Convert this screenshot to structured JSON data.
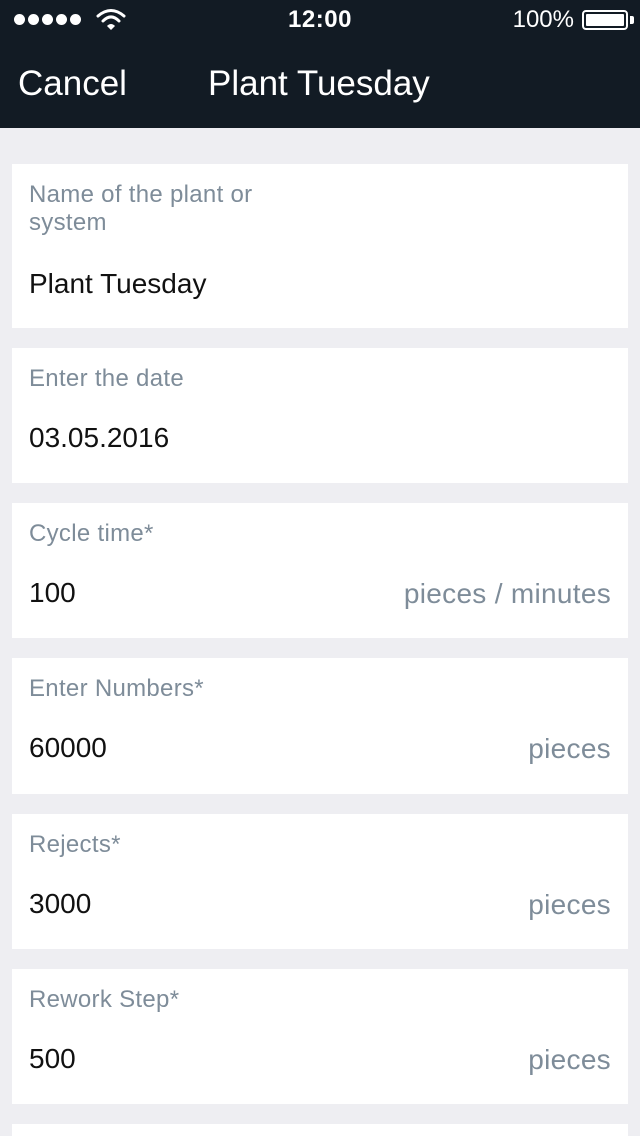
{
  "status": {
    "time": "12:00",
    "battery": "100%"
  },
  "nav": {
    "cancel": "Cancel",
    "title": "Plant Tuesday"
  },
  "fields": [
    {
      "label": "Name of the plant or system",
      "value": "Plant Tuesday",
      "unit": ""
    },
    {
      "label": "Enter the date",
      "value": "03.05.2016",
      "unit": ""
    },
    {
      "label": "Cycle time*",
      "value": "100",
      "unit": "pieces / minutes"
    },
    {
      "label": "Enter Numbers*",
      "value": "60000",
      "unit": "pieces"
    },
    {
      "label": "Rejects*",
      "value": "3000",
      "unit": "pieces"
    },
    {
      "label": "Rework Step*",
      "value": "500",
      "unit": "pieces"
    }
  ]
}
